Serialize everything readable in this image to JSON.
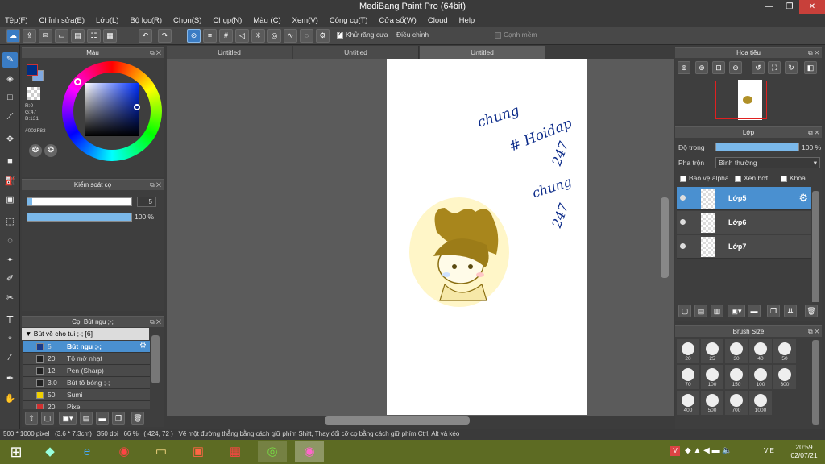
{
  "window": {
    "title": "MediBang Paint Pro (64bit)",
    "minimize": "—",
    "maximize": "❐",
    "close": "✕"
  },
  "menu": [
    "Tệp(F)",
    "Chỉnh sửa(E)",
    "Lớp(L)",
    "Bộ lọc(R)",
    "Chọn(S)",
    "Chụp(N)",
    "Màu (C)",
    "Xem(V)",
    "Công cụ(T)",
    "Cửa sổ(W)",
    "Cloud",
    "Help"
  ],
  "toolbar": {
    "antialias_label": "Khử răng cưa",
    "correction_label": "Điều chỉnh",
    "correction_value": "10",
    "edge_label": "Cạnh mềm"
  },
  "tabs": [
    "Untitled",
    "Untitled",
    "Untitled"
  ],
  "color_panel": {
    "title": "Màu",
    "r": "R:0",
    "g": "G:47",
    "b": "B:131",
    "hex": "#002F83",
    "primary_color": "#002F83",
    "secondary_color": "#7fa8e0"
  },
  "brush_control": {
    "title": "Kiểm soát cọ",
    "size_value": "5",
    "size_fraction": 0.05,
    "opacity_value": "100 %",
    "opacity_fraction": 1.0
  },
  "brush_panel": {
    "title": "Cọ: Bút ngu ;-;",
    "group_name": "Bút vẽ cho tui ;-; [6]",
    "items": [
      {
        "color": "#1a3a8a",
        "size": "5",
        "name": "Bút ngu ;-;"
      },
      {
        "color": "#222222",
        "size": "20",
        "name": "Tô mờ nhạt"
      },
      {
        "color": "#222222",
        "size": "12",
        "name": "Pen (Sharp)"
      },
      {
        "color": "#222222",
        "size": "3.0",
        "name": "Bút tô bóng ;-;"
      },
      {
        "color": "#f0d000",
        "size": "50",
        "name": "Sumi"
      },
      {
        "color": "#d03030",
        "size": "20",
        "name": "Pixel"
      }
    ]
  },
  "navigator": {
    "title": "Hoa tiêu"
  },
  "layer_panel": {
    "title": "Lớp",
    "opacity_label": "Độ trong",
    "opacity_value": "100 %",
    "opacity_fraction": 1.0,
    "blend_label": "Pha trộn",
    "blend_value": "Bình thường",
    "protect_alpha": "Bảo vệ alpha",
    "clipping": "Xén bớt",
    "lock": "Khóa",
    "layers": [
      {
        "name": "Lớp5",
        "selected": true
      },
      {
        "name": "Lớp6",
        "selected": false
      },
      {
        "name": "Lớp7",
        "selected": false
      }
    ]
  },
  "brush_size_panel": {
    "title": "Brush Size",
    "sizes": [
      "20",
      "25",
      "30",
      "40",
      "50",
      "70",
      "100",
      "150",
      "100",
      "300",
      "400",
      "500",
      "700",
      "1000"
    ]
  },
  "canvas_text": {
    "line1": "chung",
    "line2": "# Hoidap",
    "line3": "247",
    "line4": "chung",
    "line5": "247"
  },
  "statusbar": {
    "size": "500 * 1000 pixel",
    "cm": "(3.6 * 7.3cm)",
    "dpi": "350 dpi",
    "zoom": "66 %",
    "coords": "( 424, 72 )",
    "hint": "Vẽ một đường thẳng bằng cách giữ phím Shift, Thay đổi cỡ cọ bằng cách giữ phím Ctrl, Alt và kéo"
  },
  "taskbar": {
    "lang": "VIE",
    "time": "20:59",
    "date": "02/07/21"
  }
}
